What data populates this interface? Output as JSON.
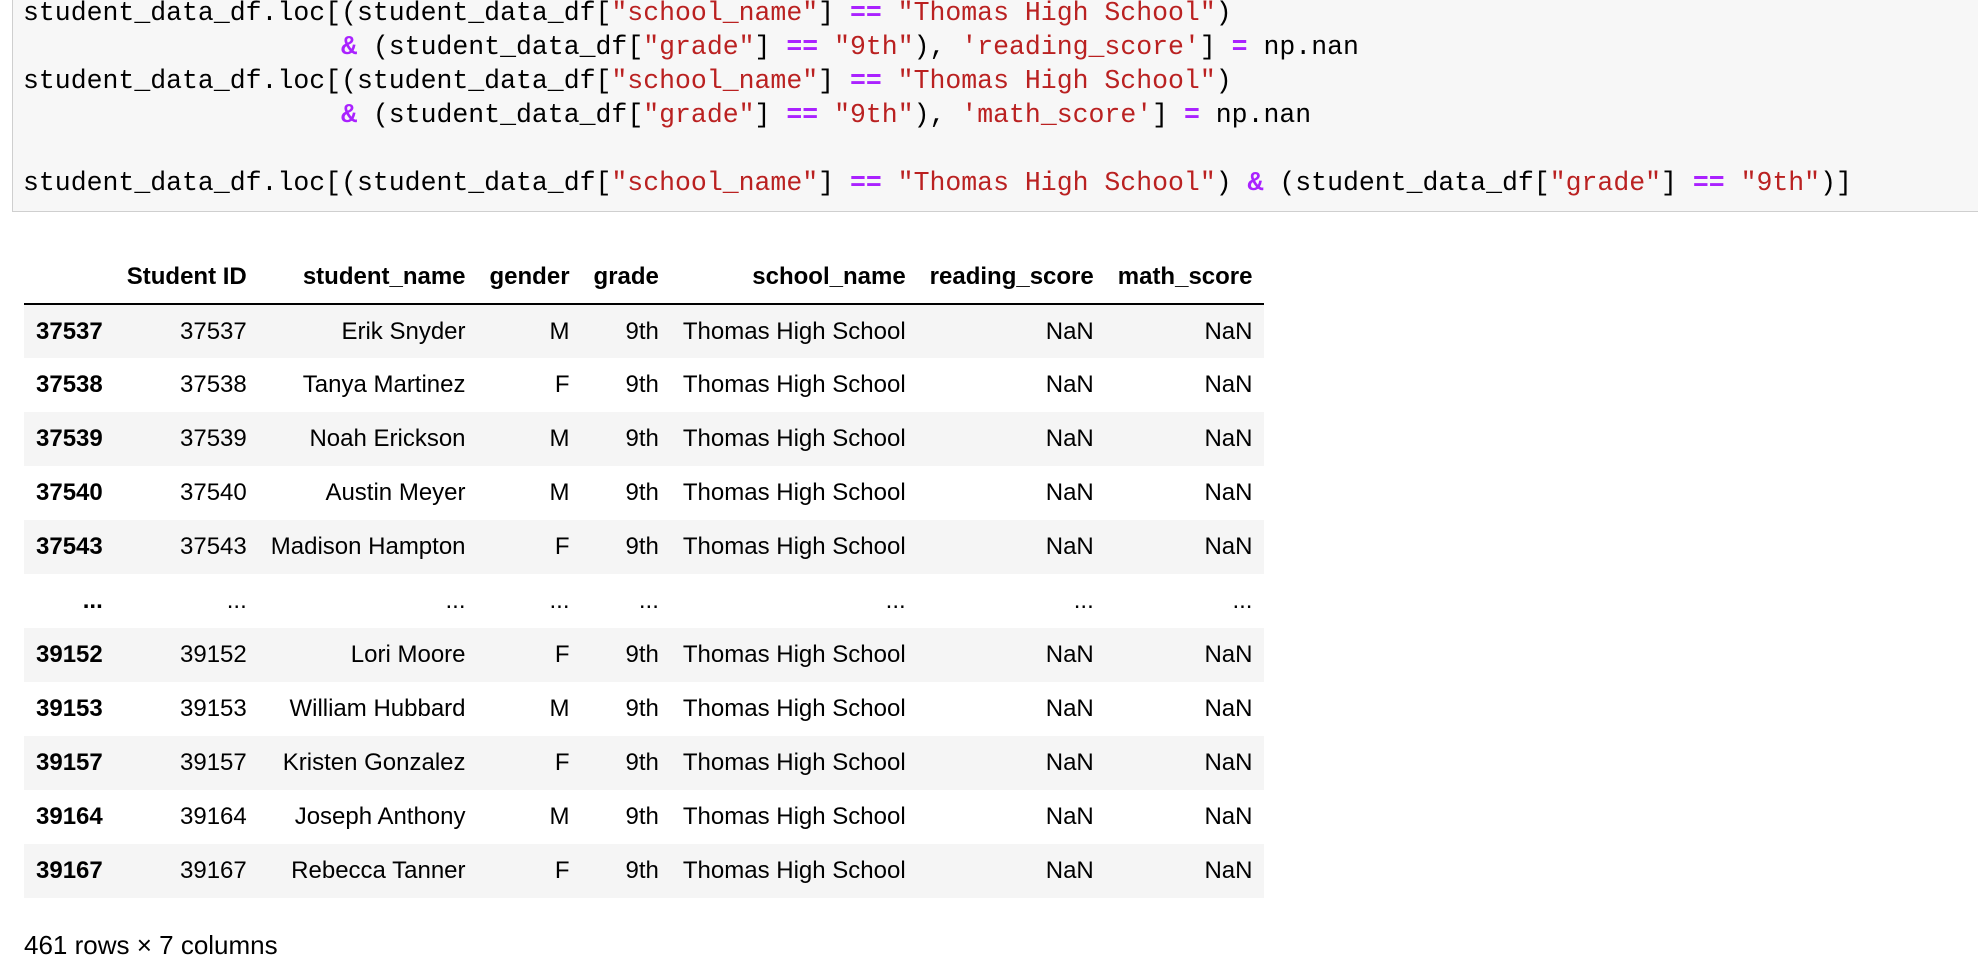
{
  "code": {
    "lines": [
      [
        {
          "t": "student_data_df.loc[(student_data_df[",
          "c": "plain"
        },
        {
          "t": "\"school_name\"",
          "c": "str"
        },
        {
          "t": "] ",
          "c": "plain"
        },
        {
          "t": "==",
          "c": "op"
        },
        {
          "t": " ",
          "c": "plain"
        },
        {
          "t": "\"Thomas High School\"",
          "c": "str"
        },
        {
          "t": ")",
          "c": "plain"
        }
      ],
      [
        {
          "t": "                    ",
          "c": "plain"
        },
        {
          "t": "&",
          "c": "op"
        },
        {
          "t": " (student_data_df[",
          "c": "plain"
        },
        {
          "t": "\"grade\"",
          "c": "str"
        },
        {
          "t": "] ",
          "c": "plain"
        },
        {
          "t": "==",
          "c": "op"
        },
        {
          "t": " ",
          "c": "plain"
        },
        {
          "t": "\"9th\"",
          "c": "str"
        },
        {
          "t": "), ",
          "c": "plain"
        },
        {
          "t": "'reading_score'",
          "c": "str"
        },
        {
          "t": "] ",
          "c": "plain"
        },
        {
          "t": "=",
          "c": "op"
        },
        {
          "t": " np.nan",
          "c": "plain"
        }
      ],
      [
        {
          "t": "student_data_df.loc[(student_data_df[",
          "c": "plain"
        },
        {
          "t": "\"school_name\"",
          "c": "str"
        },
        {
          "t": "] ",
          "c": "plain"
        },
        {
          "t": "==",
          "c": "op"
        },
        {
          "t": " ",
          "c": "plain"
        },
        {
          "t": "\"Thomas High School\"",
          "c": "str"
        },
        {
          "t": ")",
          "c": "plain"
        }
      ],
      [
        {
          "t": "                    ",
          "c": "plain"
        },
        {
          "t": "&",
          "c": "op"
        },
        {
          "t": " (student_data_df[",
          "c": "plain"
        },
        {
          "t": "\"grade\"",
          "c": "str"
        },
        {
          "t": "] ",
          "c": "plain"
        },
        {
          "t": "==",
          "c": "op"
        },
        {
          "t": " ",
          "c": "plain"
        },
        {
          "t": "\"9th\"",
          "c": "str"
        },
        {
          "t": "), ",
          "c": "plain"
        },
        {
          "t": "'math_score'",
          "c": "str"
        },
        {
          "t": "] ",
          "c": "plain"
        },
        {
          "t": "=",
          "c": "op"
        },
        {
          "t": " np.nan",
          "c": "plain"
        }
      ],
      [],
      [
        {
          "t": "student_data_df.loc[(student_data_df[",
          "c": "plain"
        },
        {
          "t": "\"school_name\"",
          "c": "str"
        },
        {
          "t": "] ",
          "c": "plain"
        },
        {
          "t": "==",
          "c": "op"
        },
        {
          "t": " ",
          "c": "plain"
        },
        {
          "t": "\"Thomas High School\"",
          "c": "str"
        },
        {
          "t": ") ",
          "c": "plain"
        },
        {
          "t": "&",
          "c": "op"
        },
        {
          "t": " (student_data_df[",
          "c": "plain"
        },
        {
          "t": "\"grade\"",
          "c": "str"
        },
        {
          "t": "] ",
          "c": "plain"
        },
        {
          "t": "==",
          "c": "op"
        },
        {
          "t": " ",
          "c": "plain"
        },
        {
          "t": "\"9th\"",
          "c": "str"
        },
        {
          "t": ")]",
          "c": "plain"
        }
      ]
    ]
  },
  "table": {
    "index_header": "",
    "columns": [
      "Student ID",
      "student_name",
      "gender",
      "grade",
      "school_name",
      "reading_score",
      "math_score"
    ],
    "rows": [
      {
        "index": "37537",
        "cells": [
          "37537",
          "Erik Snyder",
          "M",
          "9th",
          "Thomas High School",
          "NaN",
          "NaN"
        ]
      },
      {
        "index": "37538",
        "cells": [
          "37538",
          "Tanya Martinez",
          "F",
          "9th",
          "Thomas High School",
          "NaN",
          "NaN"
        ]
      },
      {
        "index": "37539",
        "cells": [
          "37539",
          "Noah Erickson",
          "M",
          "9th",
          "Thomas High School",
          "NaN",
          "NaN"
        ]
      },
      {
        "index": "37540",
        "cells": [
          "37540",
          "Austin Meyer",
          "M",
          "9th",
          "Thomas High School",
          "NaN",
          "NaN"
        ]
      },
      {
        "index": "37543",
        "cells": [
          "37543",
          "Madison Hampton",
          "F",
          "9th",
          "Thomas High School",
          "NaN",
          "NaN"
        ]
      },
      {
        "index": "...",
        "cells": [
          "...",
          "...",
          "...",
          "...",
          "...",
          "...",
          "..."
        ]
      },
      {
        "index": "39152",
        "cells": [
          "39152",
          "Lori Moore",
          "F",
          "9th",
          "Thomas High School",
          "NaN",
          "NaN"
        ]
      },
      {
        "index": "39153",
        "cells": [
          "39153",
          "William Hubbard",
          "M",
          "9th",
          "Thomas High School",
          "NaN",
          "NaN"
        ]
      },
      {
        "index": "39157",
        "cells": [
          "39157",
          "Kristen Gonzalez",
          "F",
          "9th",
          "Thomas High School",
          "NaN",
          "NaN"
        ]
      },
      {
        "index": "39164",
        "cells": [
          "39164",
          "Joseph Anthony",
          "M",
          "9th",
          "Thomas High School",
          "NaN",
          "NaN"
        ]
      },
      {
        "index": "39167",
        "cells": [
          "39167",
          "Rebecca Tanner",
          "F",
          "9th",
          "Thomas High School",
          "NaN",
          "NaN"
        ]
      }
    ]
  },
  "summary": "461 rows × 7 columns",
  "colors": {
    "string": "#ba2121",
    "operator": "#aa22ff",
    "code_background": "#f7f7f7",
    "row_stripe": "#f5f5f5"
  }
}
